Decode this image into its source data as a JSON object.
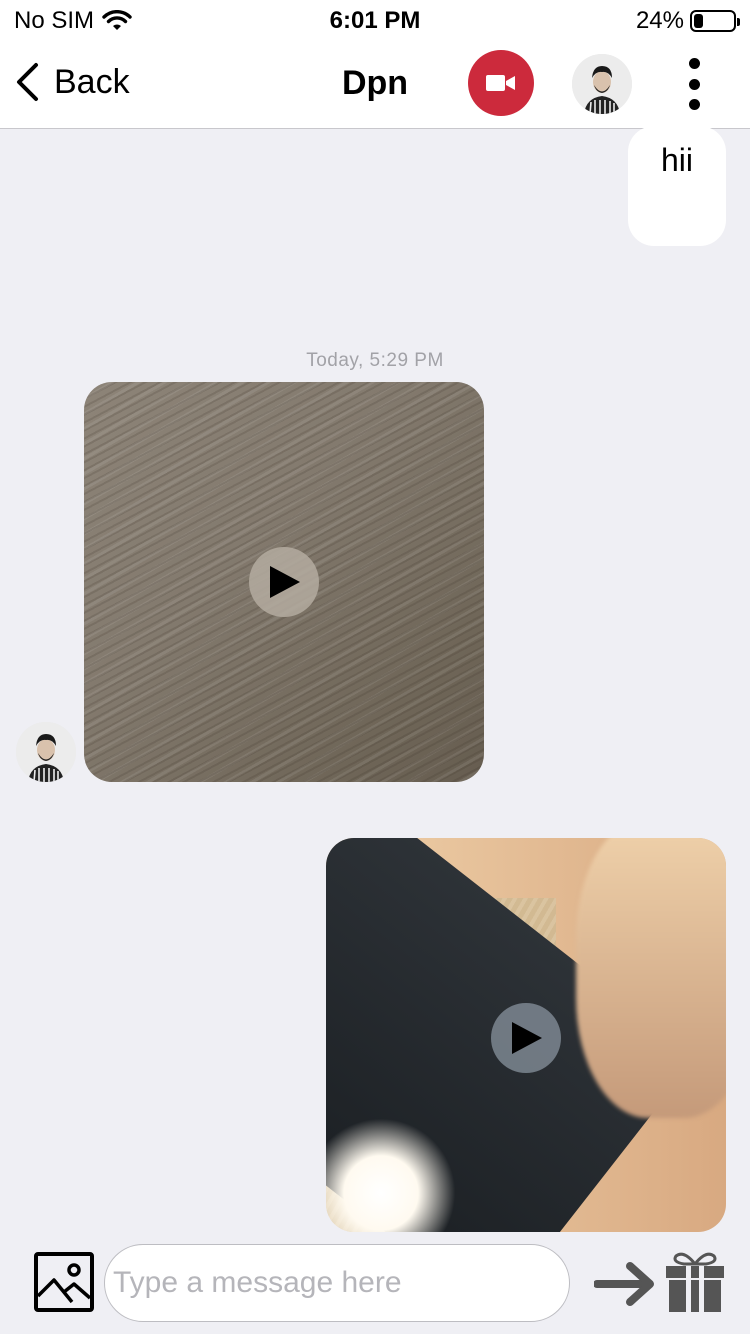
{
  "status_bar": {
    "carrier": "No SIM",
    "time": "6:01 PM",
    "battery_percent": "24%",
    "battery_level": 0.24
  },
  "nav": {
    "back_label": "Back",
    "title": "Dpn",
    "video_button_color": "#cc2a3c"
  },
  "messages": [
    {
      "type": "text",
      "direction": "outgoing",
      "text": "hii"
    },
    {
      "type": "date",
      "text": "Today, 5:29 PM"
    },
    {
      "type": "video",
      "direction": "incoming"
    },
    {
      "type": "video",
      "direction": "outgoing"
    }
  ],
  "composer": {
    "placeholder": "Type a message here",
    "value": ""
  },
  "icons": [
    "wifi-icon",
    "battery-icon",
    "back-chevron-icon",
    "video-camera-icon",
    "more-vertical-icon",
    "play-icon",
    "image-icon",
    "send-arrow-icon",
    "gift-icon"
  ]
}
